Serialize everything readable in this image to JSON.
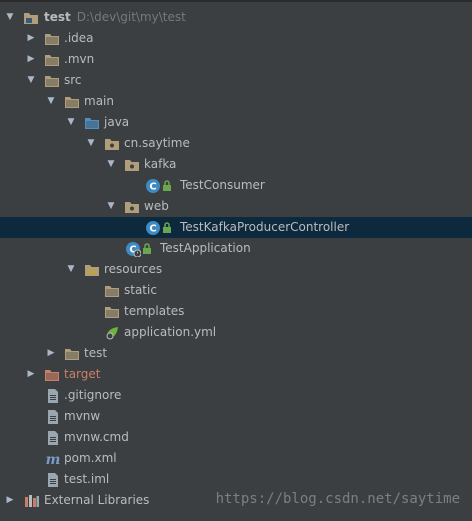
{
  "tree": {
    "root": {
      "label": "test",
      "path": "D:\\dev\\git\\my\\test",
      "icon": "module-folder-icon"
    },
    "idea": {
      "label": ".idea",
      "icon": "folder-icon"
    },
    "mvn": {
      "label": ".mvn",
      "icon": "folder-icon"
    },
    "src": {
      "label": "src",
      "icon": "folder-icon"
    },
    "main": {
      "label": "main",
      "icon": "folder-icon"
    },
    "java": {
      "label": "java",
      "icon": "source-folder-icon"
    },
    "package": {
      "label": "cn.saytime",
      "icon": "package-icon"
    },
    "kafka": {
      "label": "kafka",
      "icon": "package-icon"
    },
    "test_consumer": {
      "label": "TestConsumer",
      "icon": "java-class-icon"
    },
    "web": {
      "label": "web",
      "icon": "package-icon"
    },
    "controller": {
      "label": "TestKafkaProducerController",
      "icon": "java-class-icon"
    },
    "test_application": {
      "label": "TestApplication",
      "icon": "spring-boot-class-icon"
    },
    "resources": {
      "label": "resources",
      "icon": "resources-folder-icon"
    },
    "static": {
      "label": "static",
      "icon": "folder-icon"
    },
    "templates": {
      "label": "templates",
      "icon": "folder-icon"
    },
    "application_yml": {
      "label": "application.yml",
      "icon": "spring-config-icon"
    },
    "test_dir": {
      "label": "test",
      "icon": "folder-icon"
    },
    "target": {
      "label": "target",
      "icon": "excluded-folder-icon"
    },
    "gitignore": {
      "label": ".gitignore",
      "icon": "text-file-icon"
    },
    "mvnw": {
      "label": "mvnw",
      "icon": "text-file-icon"
    },
    "mvnw_cmd": {
      "label": "mvnw.cmd",
      "icon": "text-file-icon"
    },
    "pom": {
      "label": "pom.xml",
      "icon": "maven-file-icon"
    },
    "test_iml": {
      "label": "test.iml",
      "icon": "text-file-icon"
    },
    "external_libraries": {
      "label": "External Libraries",
      "icon": "libraries-icon"
    }
  },
  "watermark": "https://blog.csdn.net/saytime",
  "colors": {
    "background": "#3c3f41",
    "selection": "#0d293e",
    "text": "#bbbbbb",
    "folder": "#b09d79",
    "class": "#3d8bc2",
    "excluded": "#c97f67"
  }
}
